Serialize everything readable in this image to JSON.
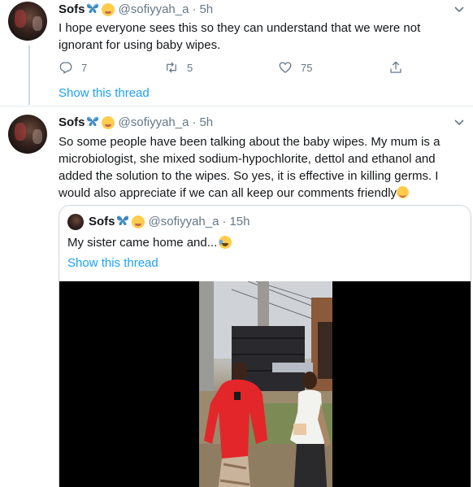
{
  "tweet1": {
    "name": "Sofs",
    "handle": "@sofiyyah_a",
    "separator": "·",
    "time": "5h",
    "text": "I hope everyone sees this so they can understand that we were not ignorant for using baby wipes.",
    "replies": "7",
    "retweets": "5",
    "likes": "75",
    "show_thread": "Show this thread"
  },
  "tweet2": {
    "name": "Sofs",
    "handle": "@sofiyyah_a",
    "separator": "·",
    "time": "5h",
    "text": "So some people have been talking about the baby wipes. My mum is a microbiologist, she mixed sodium-hypochlorite, dettol and ethanol and added the solution to the wipes. So yes,  it is effective in killing germs. I would also appreciate if we can all keep our comments friendly",
    "quote": {
      "name": "Sofs",
      "handle": "@sofiyyah_a",
      "separator": "·",
      "time": "15h",
      "text": "My sister came home and...",
      "show_thread": "Show this thread"
    }
  },
  "icons": {
    "reply": "reply-icon",
    "retweet": "retweet-icon",
    "like": "heart-icon",
    "share": "share-icon",
    "caret": "chevron-down-icon",
    "butterfly": "butterfly-emoji",
    "zany": "zany-face-emoji"
  },
  "colors": {
    "link": "#1da1f2",
    "muted": "#657786",
    "text": "#14171a",
    "border": "#e6ecf0"
  }
}
